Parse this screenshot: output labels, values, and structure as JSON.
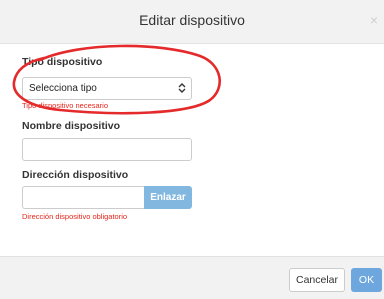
{
  "modal": {
    "title": "Editar dispositivo",
    "close_symbol": "×",
    "close_icon": "close-icon"
  },
  "form": {
    "device_type": {
      "label": "Tipo dispositivo",
      "selected": "Selecciona tipo",
      "error": "Tipo dispositivo necesario",
      "icon": "chevron-updown-icon"
    },
    "device_name": {
      "label": "Nombre dispositivo",
      "value": "",
      "placeholder": ""
    },
    "device_address": {
      "label": "Dirección dispositivo",
      "value": "",
      "placeholder": "",
      "link_button": "Enlazar",
      "error": "Dirección dispositivo obligatorio"
    }
  },
  "footer": {
    "cancel_label": "Cancelar",
    "ok_label": "OK"
  },
  "colors": {
    "header_bg": "#f2f2f2",
    "error": "#e4261c",
    "primary": "#6ea7dd",
    "link_button": "#82b8e0",
    "annotation": "#e42a2a"
  }
}
